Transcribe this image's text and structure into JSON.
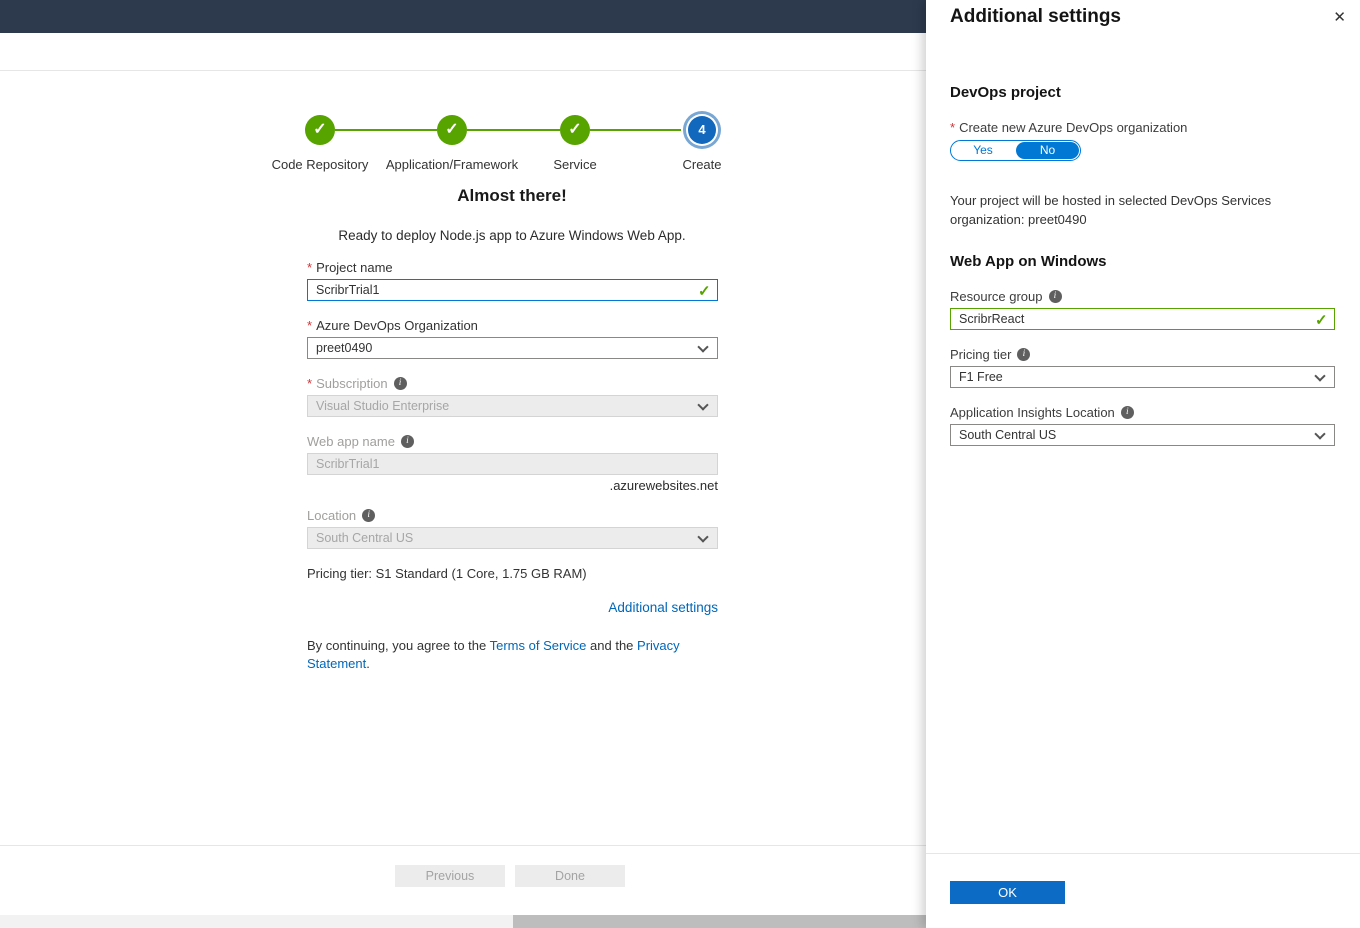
{
  "ui": {
    "required_marker": "*",
    "close_icon": "✕",
    "check_icon": "✓",
    "info_glyph": "i"
  },
  "colors": {
    "topbar": "#2d3a4e",
    "accent_blue": "#0078d4",
    "success_green": "#57a300",
    "link_blue": "#0067b8",
    "step_current_blue": "#1168bd"
  },
  "stepper": {
    "steps": [
      {
        "label": "Code Repository"
      },
      {
        "label": "Application/Framework"
      },
      {
        "label": "Service"
      },
      {
        "label": "Create",
        "number": "4"
      }
    ]
  },
  "main": {
    "heading": "Almost there!",
    "subheading": "Ready to deploy Node.js app to Azure Windows Web App.",
    "project_name": {
      "label": "Project name",
      "value": "ScribrTrial1"
    },
    "devops_org": {
      "label": "Azure DevOps Organization",
      "value": "preet0490"
    },
    "subscription": {
      "label": "Subscription",
      "value": "Visual Studio Enterprise"
    },
    "web_app_name": {
      "label": "Web app name",
      "value": "ScribrTrial1",
      "domain_suffix": ".azurewebsites.net"
    },
    "location": {
      "label": "Location",
      "value": "South Central US"
    },
    "pricing_text": "Pricing tier: S1 Standard (1 Core, 1.75 GB RAM)",
    "additional_settings_link": "Additional settings",
    "terms": {
      "prefix": "By continuing, you agree to the ",
      "terms_link": "Terms of Service",
      "middle": " and the ",
      "privacy_link": "Privacy Statement",
      "suffix": "."
    },
    "footer": {
      "previous_label": "Previous",
      "done_label": "Done"
    }
  },
  "panel": {
    "title": "Additional settings",
    "devops_section": {
      "heading": "DevOps project",
      "create_org_label": "Create new Azure DevOps organization",
      "toggle": {
        "yes": "Yes",
        "no": "No"
      },
      "hosted_text": "Your project will be hosted in selected DevOps Services organization: preet0490"
    },
    "webapp_section": {
      "heading": "Web App on Windows",
      "resource_group": {
        "label": "Resource group",
        "value": "ScribrReact"
      },
      "pricing_tier": {
        "label": "Pricing tier",
        "value": "F1 Free"
      },
      "app_insights_location": {
        "label": "Application Insights Location",
        "value": "South Central US"
      }
    },
    "ok_label": "OK"
  }
}
